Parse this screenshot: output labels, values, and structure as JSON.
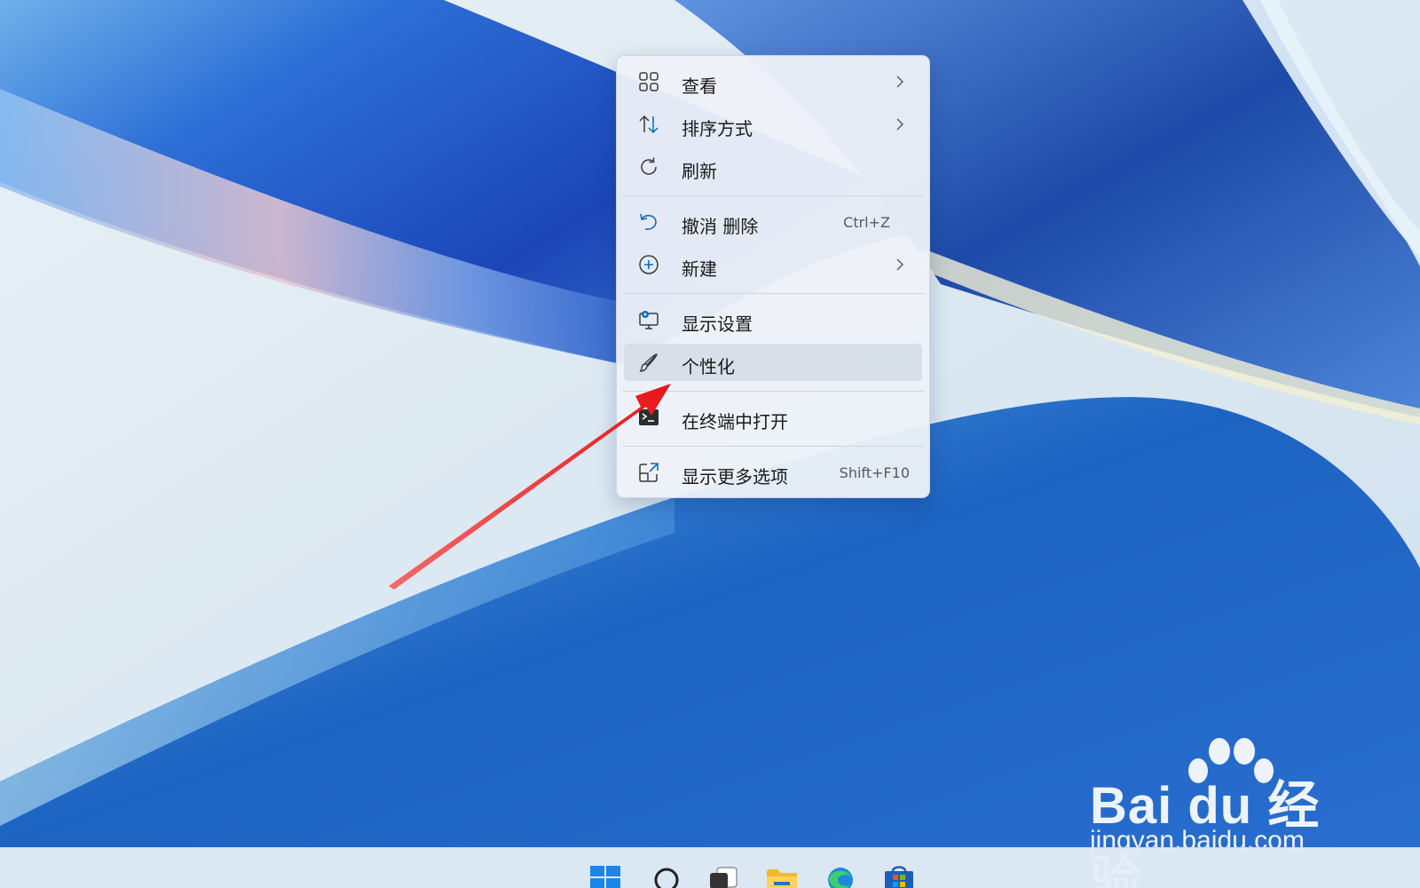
{
  "context_menu": {
    "items": [
      {
        "label": "查看",
        "icon": "grid-view-icon",
        "has_submenu": true
      },
      {
        "label": "排序方式",
        "icon": "sort-icon",
        "has_submenu": true
      },
      {
        "label": "刷新",
        "icon": "refresh-icon",
        "has_submenu": false
      },
      {
        "label": "撤消 删除",
        "icon": "undo-icon",
        "shortcut": "Ctrl+Z"
      },
      {
        "label": "新建",
        "icon": "add-circle-icon",
        "has_submenu": true
      },
      {
        "label": "显示设置",
        "icon": "display-settings-icon"
      },
      {
        "label": "个性化",
        "icon": "paintbrush-icon",
        "highlighted": true
      },
      {
        "label": "在终端中打开",
        "icon": "terminal-icon"
      },
      {
        "label": "显示更多选项",
        "icon": "expand-icon",
        "shortcut": "Shift+F10"
      }
    ]
  },
  "taskbar": {
    "icons": [
      "windows-start-icon",
      "search-icon",
      "task-view-icon",
      "file-explorer-icon",
      "edge-icon",
      "store-icon"
    ]
  },
  "watermark": {
    "brand": "Bai du 经验",
    "site": "jingyan.baidu.com"
  },
  "colors": {
    "accent": "#0067c0",
    "highlight": "#d6dde8",
    "annotation_arrow": "#e8141a"
  }
}
